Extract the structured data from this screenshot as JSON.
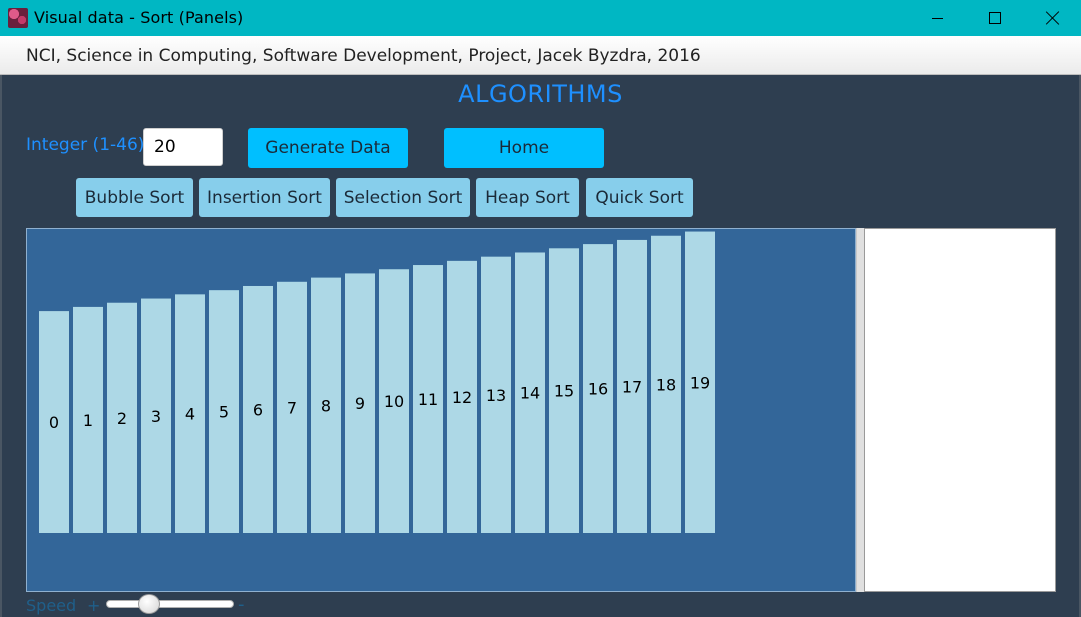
{
  "window": {
    "title": "Visual data - Sort (Panels)",
    "controls": [
      "minimize",
      "maximize",
      "close"
    ]
  },
  "menubar": {
    "text": "NCI, Science in Computing, Software Development, Project, Jacek Byzdra, 2016"
  },
  "heading": "ALGORITHMS",
  "input": {
    "label": "Integer (1-46)",
    "value": "20"
  },
  "buttons": {
    "generate": "Generate Data",
    "home": "Home"
  },
  "sort_buttons": [
    "Bubble Sort",
    "Insertion Sort",
    "Selection Sort",
    "Heap Sort",
    "Quick Sort"
  ],
  "speed": {
    "label": "Speed",
    "plus": "+",
    "minus": "-",
    "level": 0.3
  },
  "colors": {
    "titlebar": "#00b7c3",
    "accent_text": "#1e90ff",
    "primary_button": "#00bfff",
    "sort_button": "#87ceeb",
    "chart_background": "#336699",
    "bar_fill": "#add8e6",
    "app_background": "#2e3e50"
  },
  "chart_data": {
    "type": "bar",
    "categories": [
      "0",
      "1",
      "2",
      "3",
      "4",
      "5",
      "6",
      "7",
      "8",
      "9",
      "10",
      "11",
      "12",
      "13",
      "14",
      "15",
      "16",
      "17",
      "18",
      "19"
    ],
    "values": [
      53,
      54,
      55,
      56,
      57,
      58,
      59,
      60,
      61,
      62,
      63,
      64,
      65,
      66,
      67,
      68,
      69,
      70,
      71,
      72
    ],
    "title": "",
    "xlabel": "",
    "ylabel": "",
    "ylim": [
      0,
      91
    ],
    "grid": false
  }
}
